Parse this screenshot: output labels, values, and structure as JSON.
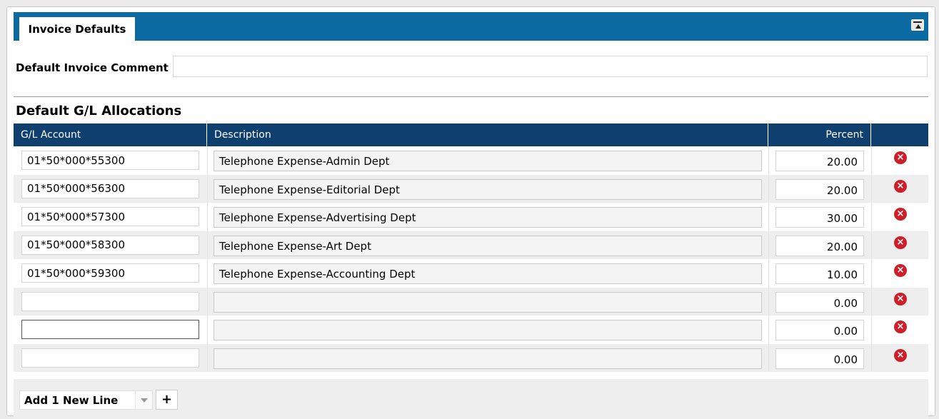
{
  "tab": {
    "label": "Invoice Defaults"
  },
  "comment": {
    "label": "Default Invoice Comment",
    "value": ""
  },
  "allocations": {
    "title": "Default G/L Allocations",
    "columns": {
      "account": "G/L Account",
      "description": "Description",
      "percent": "Percent"
    },
    "rows": [
      {
        "account": "01*50*000*55300",
        "description": "Telephone Expense-Admin Dept",
        "percent": "20.00"
      },
      {
        "account": "01*50*000*56300",
        "description": "Telephone Expense-Editorial Dept",
        "percent": "20.00"
      },
      {
        "account": "01*50*000*57300",
        "description": "Telephone Expense-Advertising Dept",
        "percent": "30.00"
      },
      {
        "account": "01*50*000*58300",
        "description": "Telephone Expense-Art Dept",
        "percent": "20.00"
      },
      {
        "account": "01*50*000*59300",
        "description": "Telephone Expense-Accounting Dept",
        "percent": "10.00"
      },
      {
        "account": "",
        "description": "",
        "percent": "0.00"
      },
      {
        "account": "",
        "description": "",
        "percent": "0.00"
      },
      {
        "account": "",
        "description": "",
        "percent": "0.00"
      }
    ]
  },
  "footer": {
    "add_line_option": "Add 1 New Line",
    "add_button": "+"
  },
  "icons": {
    "delete": "delete-circle-icon",
    "collapse": "collapse-panel-icon"
  },
  "colors": {
    "tab_bar": "#0a6aa1",
    "table_header": "#0e3f6e",
    "delete": "#cc1f2a"
  }
}
